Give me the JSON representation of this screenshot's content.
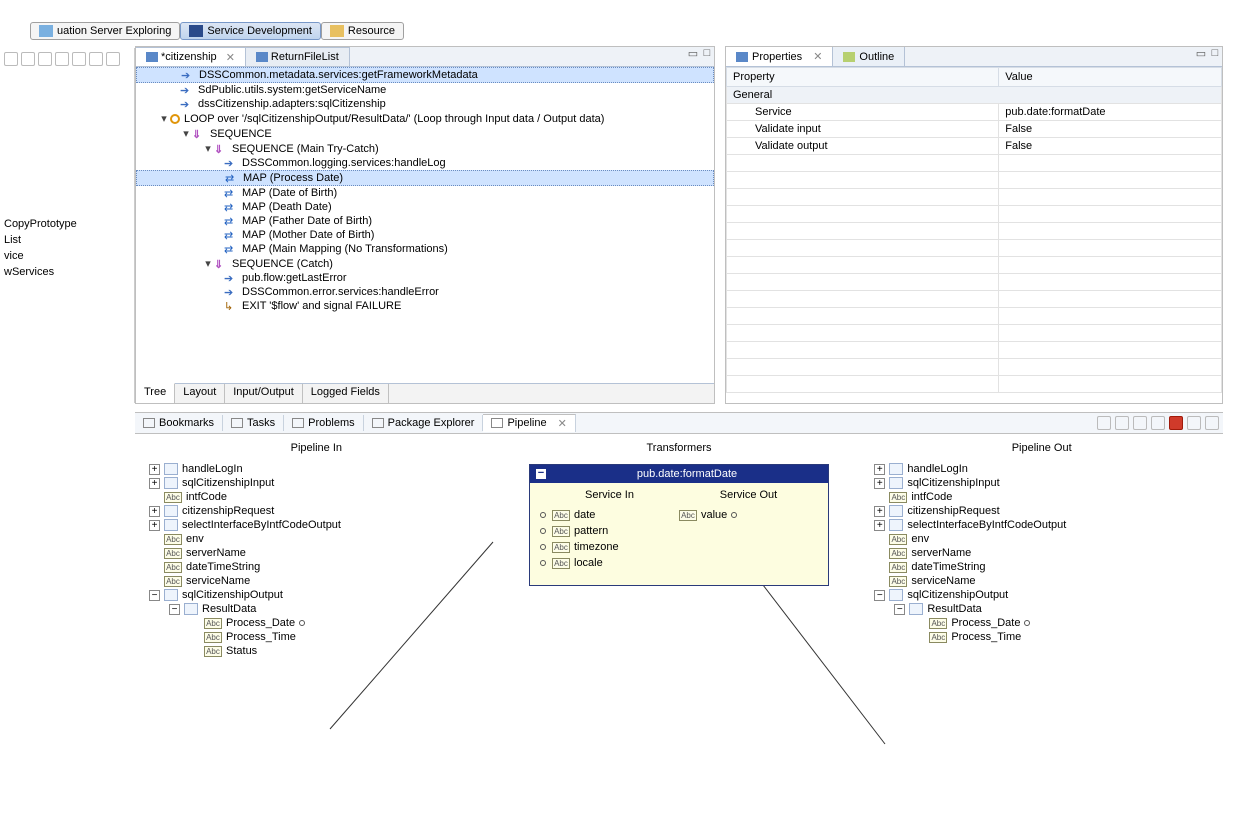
{
  "perspectives": [
    {
      "label": "uation Server Exploring"
    },
    {
      "label": "Service Development",
      "active": true
    },
    {
      "label": "Resource"
    }
  ],
  "leftStrip": {
    "items": [
      "CopyPrototype",
      "List",
      "vice",
      "wServices"
    ]
  },
  "editor": {
    "tabs": [
      {
        "label": "*citizenship",
        "active": true,
        "closeGlyph": "✕"
      },
      {
        "label": "ReturnFileList",
        "active": false
      }
    ],
    "bottomTabs": [
      "Tree",
      "Layout",
      "Input/Output",
      "Logged Fields"
    ],
    "tree": [
      {
        "indent": 1,
        "icon": "invoke",
        "label": "DSSCommon.metadata.services:getFrameworkMetadata",
        "selected": true
      },
      {
        "indent": 1,
        "icon": "invoke",
        "label": "SdPublic.utils.system:getServiceName"
      },
      {
        "indent": 1,
        "icon": "invoke",
        "label": "dssCitizenship.adapters:sqlCitizenship"
      },
      {
        "indent": 0,
        "twisty": "▾",
        "icon": "loop",
        "label": "LOOP over '/sqlCitizenshipOutput/ResultData/' (Loop through Input data / Output data)"
      },
      {
        "indent": 1,
        "twisty": "▾",
        "icon": "seq",
        "label": "SEQUENCE"
      },
      {
        "indent": 2,
        "twisty": "▾",
        "icon": "seq",
        "label": "SEQUENCE (Main Try-Catch)"
      },
      {
        "indent": 3,
        "icon": "invoke",
        "label": "DSSCommon.logging.services:handleLog"
      },
      {
        "indent": 3,
        "icon": "map",
        "label": "MAP (Process Date)",
        "selected": true
      },
      {
        "indent": 3,
        "icon": "map",
        "label": "MAP (Date of Birth)"
      },
      {
        "indent": 3,
        "icon": "map",
        "label": "MAP (Death Date)"
      },
      {
        "indent": 3,
        "icon": "map",
        "label": "MAP (Father Date of Birth)"
      },
      {
        "indent": 3,
        "icon": "map",
        "label": "MAP (Mother Date of Birth)"
      },
      {
        "indent": 3,
        "icon": "map",
        "label": "MAP (Main Mapping (No Transformations)"
      },
      {
        "indent": 2,
        "twisty": "▾",
        "icon": "seq",
        "label": "SEQUENCE (Catch)"
      },
      {
        "indent": 3,
        "icon": "invoke",
        "label": "pub.flow:getLastError"
      },
      {
        "indent": 3,
        "icon": "invoke",
        "label": "DSSCommon.error.services:handleError"
      },
      {
        "indent": 3,
        "icon": "exit",
        "label": "EXIT '$flow' and signal FAILURE"
      }
    ]
  },
  "properties": {
    "tabs": [
      {
        "label": "Properties",
        "active": true,
        "closeGlyph": "✕"
      },
      {
        "label": "Outline"
      }
    ],
    "headers": {
      "col1": "Property",
      "col2": "Value"
    },
    "group": "General",
    "rows": [
      {
        "prop": "Service",
        "val": "pub.date:formatDate"
      },
      {
        "prop": "Validate input",
        "val": "False"
      },
      {
        "prop": "Validate output",
        "val": "False"
      }
    ]
  },
  "views": {
    "tabs": [
      "Bookmarks",
      "Tasks",
      "Problems",
      "Package Explorer",
      "Pipeline"
    ],
    "active": 4,
    "closeGlyph": "✕"
  },
  "pipeline": {
    "headers": {
      "in": "Pipeline In",
      "mid": "Transformers",
      "out": "Pipeline Out"
    },
    "transformer": {
      "title": "pub.date:formatDate",
      "svcIn": "Service In",
      "svcOut": "Service Out",
      "inputs": [
        "date",
        "pattern",
        "timezone",
        "locale"
      ],
      "outputs": [
        "value"
      ]
    },
    "inTree": [
      {
        "exp": "+",
        "doc": true,
        "label": "handleLogIn"
      },
      {
        "exp": "+",
        "doc": true,
        "label": "sqlCitizenshipInput"
      },
      {
        "str": true,
        "label": "intfCode"
      },
      {
        "exp": "+",
        "doc": true,
        "label": "citizenshipRequest"
      },
      {
        "exp": "+",
        "doc": true,
        "label": "selectInterfaceByIntfCodeOutput"
      },
      {
        "str": true,
        "label": "env"
      },
      {
        "str": true,
        "label": "serverName"
      },
      {
        "str": true,
        "label": "dateTimeString"
      },
      {
        "str": true,
        "label": "serviceName"
      },
      {
        "exp": "−",
        "doc": true,
        "label": "sqlCitizenshipOutput"
      },
      {
        "indent": 1,
        "exp": "−",
        "doc": true,
        "label": "ResultData"
      },
      {
        "indent": 2,
        "str": true,
        "label": "Process_Date",
        "port": true
      },
      {
        "indent": 2,
        "str": true,
        "label": "Process_Time"
      },
      {
        "indent": 2,
        "str": true,
        "label": "Status"
      }
    ],
    "outTree": [
      {
        "exp": "+",
        "doc": true,
        "label": "handleLogIn"
      },
      {
        "exp": "+",
        "doc": true,
        "label": "sqlCitizenshipInput"
      },
      {
        "str": true,
        "label": "intfCode"
      },
      {
        "exp": "+",
        "doc": true,
        "label": "citizenshipRequest"
      },
      {
        "exp": "+",
        "doc": true,
        "label": "selectInterfaceByIntfCodeOutput"
      },
      {
        "str": true,
        "label": "env"
      },
      {
        "str": true,
        "label": "serverName"
      },
      {
        "str": true,
        "label": "dateTimeString"
      },
      {
        "str": true,
        "label": "serviceName"
      },
      {
        "exp": "−",
        "doc": true,
        "label": "sqlCitizenshipOutput"
      },
      {
        "indent": 1,
        "exp": "−",
        "doc": true,
        "label": "ResultData"
      },
      {
        "indent": 2,
        "str": true,
        "label": "Process_Date",
        "port": true
      },
      {
        "indent": 2,
        "str": true,
        "label": "Process_Time"
      }
    ]
  }
}
